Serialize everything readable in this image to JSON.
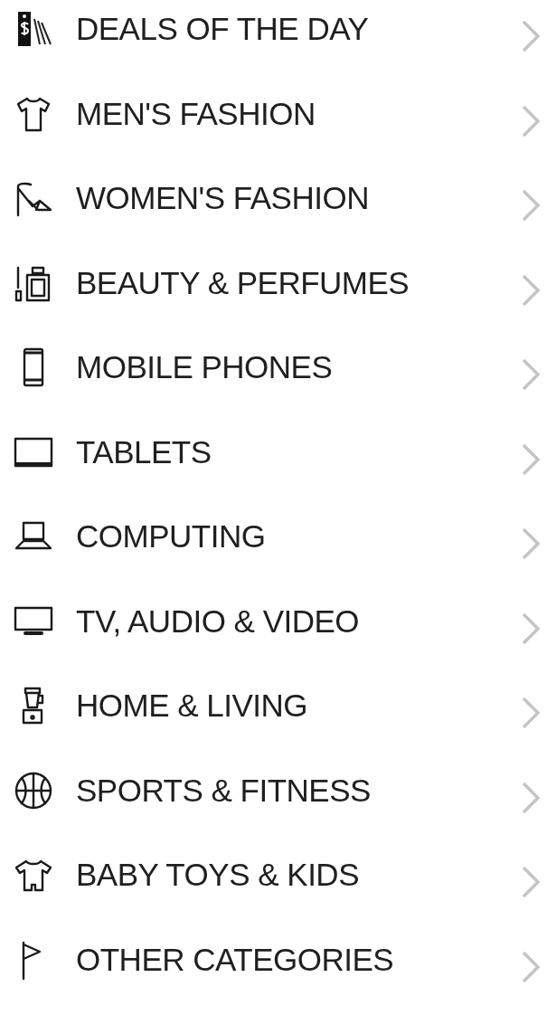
{
  "categories": [
    {
      "label": "DEALS OF THE DAY"
    },
    {
      "label": "MEN'S FASHION"
    },
    {
      "label": "WOMEN'S FASHION"
    },
    {
      "label": "BEAUTY & PERFUMES"
    },
    {
      "label": "MOBILE PHONES"
    },
    {
      "label": "TABLETS"
    },
    {
      "label": "COMPUTING"
    },
    {
      "label": "TV, AUDIO & VIDEO"
    },
    {
      "label": "HOME & LIVING"
    },
    {
      "label": "SPORTS & FITNESS"
    },
    {
      "label": "BABY TOYS & KIDS"
    },
    {
      "label": "OTHER CATEGORIES"
    }
  ]
}
